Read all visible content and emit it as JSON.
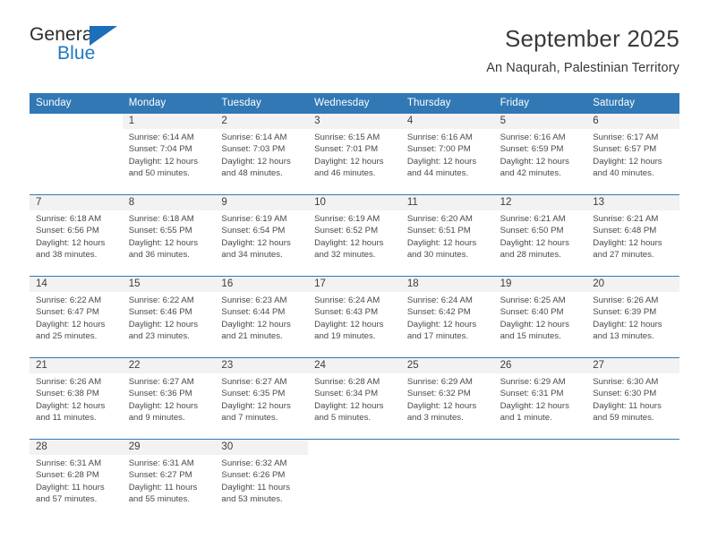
{
  "brand": {
    "name_part1": "General",
    "name_part2": "Blue",
    "logo_icon": "triangle-flag-icon",
    "colors": {
      "dark": "#2b2b2b",
      "blue": "#2079c4",
      "triangle": "#1d6fb8"
    }
  },
  "header": {
    "title": "September 2025",
    "location": "An Naqurah, Palestinian Territory"
  },
  "colors": {
    "header_bar": "#3178b4",
    "day_band": "#f2f2f2",
    "week_divider": "#3178b4",
    "text": "#4a4a4a"
  },
  "weekdays": [
    {
      "label": "Sunday"
    },
    {
      "label": "Monday"
    },
    {
      "label": "Tuesday"
    },
    {
      "label": "Wednesday"
    },
    {
      "label": "Thursday"
    },
    {
      "label": "Friday"
    },
    {
      "label": "Saturday"
    }
  ],
  "weeks": [
    {
      "days": [
        {
          "day": "",
          "sunrise": "",
          "sunset": "",
          "daylight1": "",
          "daylight2": ""
        },
        {
          "day": "1",
          "sunrise": "Sunrise: 6:14 AM",
          "sunset": "Sunset: 7:04 PM",
          "daylight1": "Daylight: 12 hours",
          "daylight2": "and 50 minutes."
        },
        {
          "day": "2",
          "sunrise": "Sunrise: 6:14 AM",
          "sunset": "Sunset: 7:03 PM",
          "daylight1": "Daylight: 12 hours",
          "daylight2": "and 48 minutes."
        },
        {
          "day": "3",
          "sunrise": "Sunrise: 6:15 AM",
          "sunset": "Sunset: 7:01 PM",
          "daylight1": "Daylight: 12 hours",
          "daylight2": "and 46 minutes."
        },
        {
          "day": "4",
          "sunrise": "Sunrise: 6:16 AM",
          "sunset": "Sunset: 7:00 PM",
          "daylight1": "Daylight: 12 hours",
          "daylight2": "and 44 minutes."
        },
        {
          "day": "5",
          "sunrise": "Sunrise: 6:16 AM",
          "sunset": "Sunset: 6:59 PM",
          "daylight1": "Daylight: 12 hours",
          "daylight2": "and 42 minutes."
        },
        {
          "day": "6",
          "sunrise": "Sunrise: 6:17 AM",
          "sunset": "Sunset: 6:57 PM",
          "daylight1": "Daylight: 12 hours",
          "daylight2": "and 40 minutes."
        }
      ]
    },
    {
      "days": [
        {
          "day": "7",
          "sunrise": "Sunrise: 6:18 AM",
          "sunset": "Sunset: 6:56 PM",
          "daylight1": "Daylight: 12 hours",
          "daylight2": "and 38 minutes."
        },
        {
          "day": "8",
          "sunrise": "Sunrise: 6:18 AM",
          "sunset": "Sunset: 6:55 PM",
          "daylight1": "Daylight: 12 hours",
          "daylight2": "and 36 minutes."
        },
        {
          "day": "9",
          "sunrise": "Sunrise: 6:19 AM",
          "sunset": "Sunset: 6:54 PM",
          "daylight1": "Daylight: 12 hours",
          "daylight2": "and 34 minutes."
        },
        {
          "day": "10",
          "sunrise": "Sunrise: 6:19 AM",
          "sunset": "Sunset: 6:52 PM",
          "daylight1": "Daylight: 12 hours",
          "daylight2": "and 32 minutes."
        },
        {
          "day": "11",
          "sunrise": "Sunrise: 6:20 AM",
          "sunset": "Sunset: 6:51 PM",
          "daylight1": "Daylight: 12 hours",
          "daylight2": "and 30 minutes."
        },
        {
          "day": "12",
          "sunrise": "Sunrise: 6:21 AM",
          "sunset": "Sunset: 6:50 PM",
          "daylight1": "Daylight: 12 hours",
          "daylight2": "and 28 minutes."
        },
        {
          "day": "13",
          "sunrise": "Sunrise: 6:21 AM",
          "sunset": "Sunset: 6:48 PM",
          "daylight1": "Daylight: 12 hours",
          "daylight2": "and 27 minutes."
        }
      ]
    },
    {
      "days": [
        {
          "day": "14",
          "sunrise": "Sunrise: 6:22 AM",
          "sunset": "Sunset: 6:47 PM",
          "daylight1": "Daylight: 12 hours",
          "daylight2": "and 25 minutes."
        },
        {
          "day": "15",
          "sunrise": "Sunrise: 6:22 AM",
          "sunset": "Sunset: 6:46 PM",
          "daylight1": "Daylight: 12 hours",
          "daylight2": "and 23 minutes."
        },
        {
          "day": "16",
          "sunrise": "Sunrise: 6:23 AM",
          "sunset": "Sunset: 6:44 PM",
          "daylight1": "Daylight: 12 hours",
          "daylight2": "and 21 minutes."
        },
        {
          "day": "17",
          "sunrise": "Sunrise: 6:24 AM",
          "sunset": "Sunset: 6:43 PM",
          "daylight1": "Daylight: 12 hours",
          "daylight2": "and 19 minutes."
        },
        {
          "day": "18",
          "sunrise": "Sunrise: 6:24 AM",
          "sunset": "Sunset: 6:42 PM",
          "daylight1": "Daylight: 12 hours",
          "daylight2": "and 17 minutes."
        },
        {
          "day": "19",
          "sunrise": "Sunrise: 6:25 AM",
          "sunset": "Sunset: 6:40 PM",
          "daylight1": "Daylight: 12 hours",
          "daylight2": "and 15 minutes."
        },
        {
          "day": "20",
          "sunrise": "Sunrise: 6:26 AM",
          "sunset": "Sunset: 6:39 PM",
          "daylight1": "Daylight: 12 hours",
          "daylight2": "and 13 minutes."
        }
      ]
    },
    {
      "days": [
        {
          "day": "21",
          "sunrise": "Sunrise: 6:26 AM",
          "sunset": "Sunset: 6:38 PM",
          "daylight1": "Daylight: 12 hours",
          "daylight2": "and 11 minutes."
        },
        {
          "day": "22",
          "sunrise": "Sunrise: 6:27 AM",
          "sunset": "Sunset: 6:36 PM",
          "daylight1": "Daylight: 12 hours",
          "daylight2": "and 9 minutes."
        },
        {
          "day": "23",
          "sunrise": "Sunrise: 6:27 AM",
          "sunset": "Sunset: 6:35 PM",
          "daylight1": "Daylight: 12 hours",
          "daylight2": "and 7 minutes."
        },
        {
          "day": "24",
          "sunrise": "Sunrise: 6:28 AM",
          "sunset": "Sunset: 6:34 PM",
          "daylight1": "Daylight: 12 hours",
          "daylight2": "and 5 minutes."
        },
        {
          "day": "25",
          "sunrise": "Sunrise: 6:29 AM",
          "sunset": "Sunset: 6:32 PM",
          "daylight1": "Daylight: 12 hours",
          "daylight2": "and 3 minutes."
        },
        {
          "day": "26",
          "sunrise": "Sunrise: 6:29 AM",
          "sunset": "Sunset: 6:31 PM",
          "daylight1": "Daylight: 12 hours",
          "daylight2": "and 1 minute."
        },
        {
          "day": "27",
          "sunrise": "Sunrise: 6:30 AM",
          "sunset": "Sunset: 6:30 PM",
          "daylight1": "Daylight: 11 hours",
          "daylight2": "and 59 minutes."
        }
      ]
    },
    {
      "days": [
        {
          "day": "28",
          "sunrise": "Sunrise: 6:31 AM",
          "sunset": "Sunset: 6:28 PM",
          "daylight1": "Daylight: 11 hours",
          "daylight2": "and 57 minutes."
        },
        {
          "day": "29",
          "sunrise": "Sunrise: 6:31 AM",
          "sunset": "Sunset: 6:27 PM",
          "daylight1": "Daylight: 11 hours",
          "daylight2": "and 55 minutes."
        },
        {
          "day": "30",
          "sunrise": "Sunrise: 6:32 AM",
          "sunset": "Sunset: 6:26 PM",
          "daylight1": "Daylight: 11 hours",
          "daylight2": "and 53 minutes."
        },
        {
          "day": "",
          "sunrise": "",
          "sunset": "",
          "daylight1": "",
          "daylight2": ""
        },
        {
          "day": "",
          "sunrise": "",
          "sunset": "",
          "daylight1": "",
          "daylight2": ""
        },
        {
          "day": "",
          "sunrise": "",
          "sunset": "",
          "daylight1": "",
          "daylight2": ""
        },
        {
          "day": "",
          "sunrise": "",
          "sunset": "",
          "daylight1": "",
          "daylight2": ""
        }
      ]
    }
  ]
}
